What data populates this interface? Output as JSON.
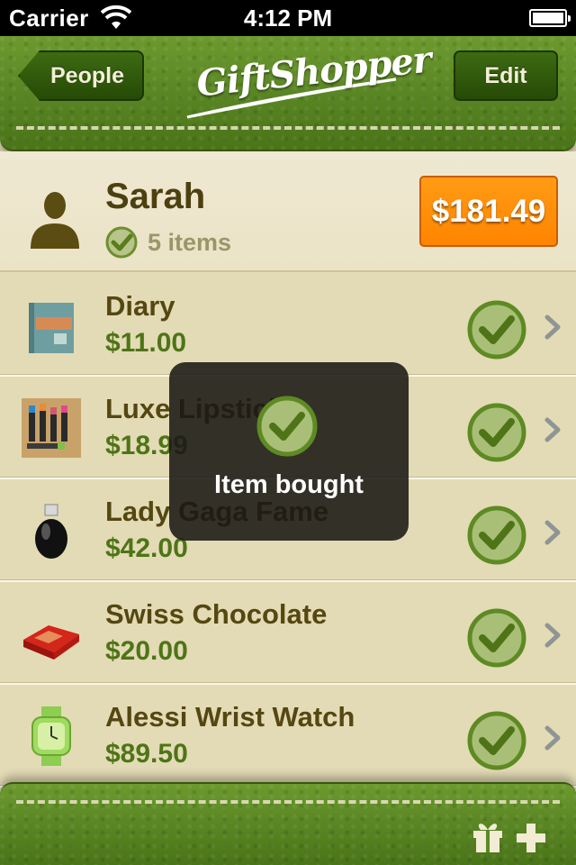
{
  "status_bar": {
    "carrier": "Carrier",
    "time": "4:12 PM"
  },
  "header": {
    "app_title": "GiftShopper",
    "back_label": "People",
    "edit_label": "Edit"
  },
  "person": {
    "name": "Sarah",
    "item_count": "5 items",
    "total": "$181.49"
  },
  "items": [
    {
      "name": "Diary",
      "price": "$11.00",
      "icon": "diary-thumbnail",
      "bought": true
    },
    {
      "name": "Luxe Lipstick",
      "price": "$18.99",
      "icon": "lipstick-thumbnail",
      "bought": true
    },
    {
      "name": "Lady Gaga Fame",
      "price": "$42.00",
      "icon": "perfume-thumbnail",
      "bought": true
    },
    {
      "name": "Swiss Chocolate",
      "price": "$20.00",
      "icon": "chocolate-box-thumbnail",
      "bought": true
    },
    {
      "name": "Alessi Wrist Watch",
      "price": "$89.50",
      "icon": "watch-thumbnail",
      "bought": true
    }
  ],
  "hud": {
    "message": "Item bought"
  },
  "colors": {
    "leather_green": "#5b8825",
    "total_orange": "#ff8a00",
    "check_green": "#5e8a23",
    "title_brown": "#554712",
    "price_green": "#4e7417"
  }
}
